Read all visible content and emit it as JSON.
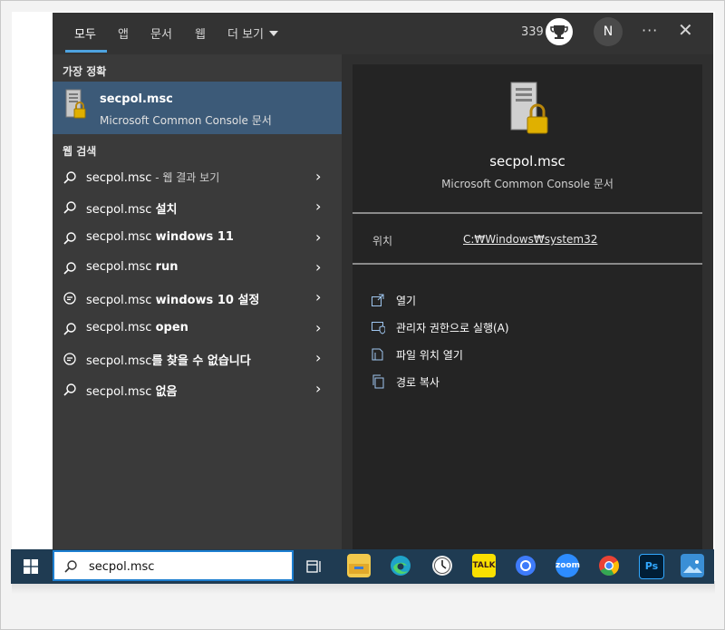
{
  "tabs": [
    {
      "label": "모두",
      "active": true
    },
    {
      "label": "앱"
    },
    {
      "label": "문서"
    },
    {
      "label": "웹"
    },
    {
      "label": "더 보기"
    }
  ],
  "header": {
    "points": "339",
    "avatar_initial": "N",
    "more": "···",
    "close": "✕"
  },
  "best_match": {
    "section_label": "가장 정확",
    "title": "secpol.msc",
    "subtitle": "Microsoft Common Console 문서"
  },
  "web_search": {
    "section_label": "웹 검색",
    "rows": [
      {
        "icon": "search-icon",
        "plain": "secpol.msc",
        "bold": "",
        "muted": " - 웹 결과 보기"
      },
      {
        "icon": "search-icon",
        "plain": "secpol.msc ",
        "bold": "설치",
        "muted": ""
      },
      {
        "icon": "search-icon",
        "plain": "secpol.msc ",
        "bold": "windows 11",
        "muted": ""
      },
      {
        "icon": "search-icon",
        "plain": "secpol.msc ",
        "bold": "run",
        "muted": ""
      },
      {
        "icon": "chat-icon",
        "plain": "secpol.msc ",
        "bold": "windows 10 설정",
        "muted": ""
      },
      {
        "icon": "search-icon",
        "plain": "secpol.msc ",
        "bold": "open",
        "muted": ""
      },
      {
        "icon": "chat-icon",
        "plain": "secpol.msc",
        "bold": "를 찾을 수 없습니다",
        "muted": ""
      },
      {
        "icon": "search-icon",
        "plain": "secpol.msc ",
        "bold": "없음",
        "muted": ""
      }
    ]
  },
  "details": {
    "title": "secpol.msc",
    "subtitle": "Microsoft Common Console 문서",
    "location_label": "위치",
    "location_path": "C:₩Windows₩system32",
    "actions": [
      {
        "icon": "open-icon",
        "label": "열기"
      },
      {
        "icon": "admin-shield-icon",
        "label": "관리자 권한으로 실행(A)"
      },
      {
        "icon": "folder-location-icon",
        "label": "파일 위치 열기"
      },
      {
        "icon": "copy-path-icon",
        "label": "경로 복사"
      }
    ]
  },
  "taskbar": {
    "search_value": "secpol.msc",
    "apps": [
      {
        "name": "file-explorer-icon",
        "text": "",
        "color": "#f2c94c"
      },
      {
        "name": "edge-icon",
        "text": "",
        "color": "#2b9ad8"
      },
      {
        "name": "clock-app-icon",
        "text": "",
        "color": "#e8e8e8"
      },
      {
        "name": "kakaotalk-icon",
        "text": "TALK",
        "color": "#f9e000"
      },
      {
        "name": "chat-app-icon",
        "text": "",
        "color": "#3e7bfa"
      },
      {
        "name": "zoom-icon",
        "text": "zoom",
        "color": "#2d8cff"
      },
      {
        "name": "chrome-icon",
        "text": "",
        "color": "#34a853"
      },
      {
        "name": "photoshop-icon",
        "text": "Ps",
        "color": "#001e36"
      },
      {
        "name": "photos-icon",
        "text": "",
        "color": "#3a8fd6"
      }
    ]
  }
}
